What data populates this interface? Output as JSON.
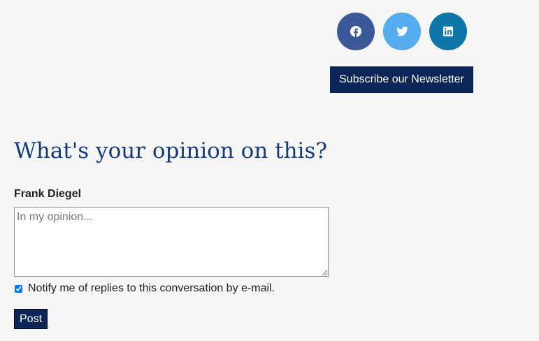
{
  "social": {
    "items": [
      {
        "icon": "facebook-icon",
        "color": "#3b5998"
      },
      {
        "icon": "twitter-icon",
        "color": "#55acee"
      },
      {
        "icon": "linkedin-icon",
        "color": "#0e76a8"
      }
    ]
  },
  "newsletter": {
    "label": "Subscribe our Newsletter",
    "color": "#0c2657"
  },
  "comments": {
    "title": "What's your opinion on this?",
    "title_color": "#163a80",
    "author": "Frank Diegel",
    "textarea_placeholder": "In my opinion...",
    "textarea_value": "",
    "notify_label": "Notify me of replies to this conversation by e-mail.",
    "notify_checked": true,
    "post_label": "Post"
  }
}
